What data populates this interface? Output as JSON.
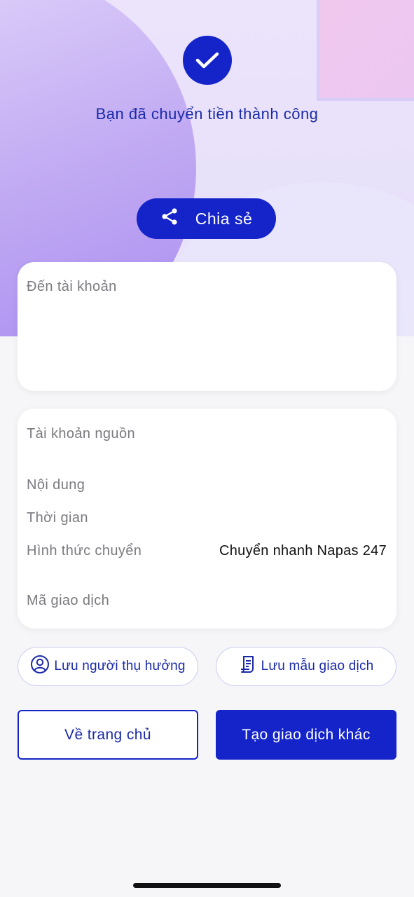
{
  "status": {
    "message": "Bạn đã chuyển tiền thành công",
    "accent": "#1424c9"
  },
  "actions": {
    "share_label": "Chia sẻ"
  },
  "recipient_card": {
    "to_account_label": "Đến tài khoản"
  },
  "details": {
    "source_account_label": "Tài khoản nguồn",
    "content_label": "Nội dung",
    "time_label": "Thời gian",
    "transfer_method_label": "Hình thức chuyển",
    "transfer_method_value": "Chuyển nhanh Napas 247",
    "transaction_id_label": "Mã giao dịch"
  },
  "quick_actions": {
    "save_beneficiary_label": "Lưu người thụ hưởng",
    "save_template_label": "Lưu mẫu giao dịch"
  },
  "footer": {
    "home_label": "Về trang chủ",
    "new_transaction_label": "Tạo giao dịch khác"
  },
  "icons": [
    "check-icon",
    "share-icon",
    "user-circle-icon",
    "receipt-icon"
  ]
}
